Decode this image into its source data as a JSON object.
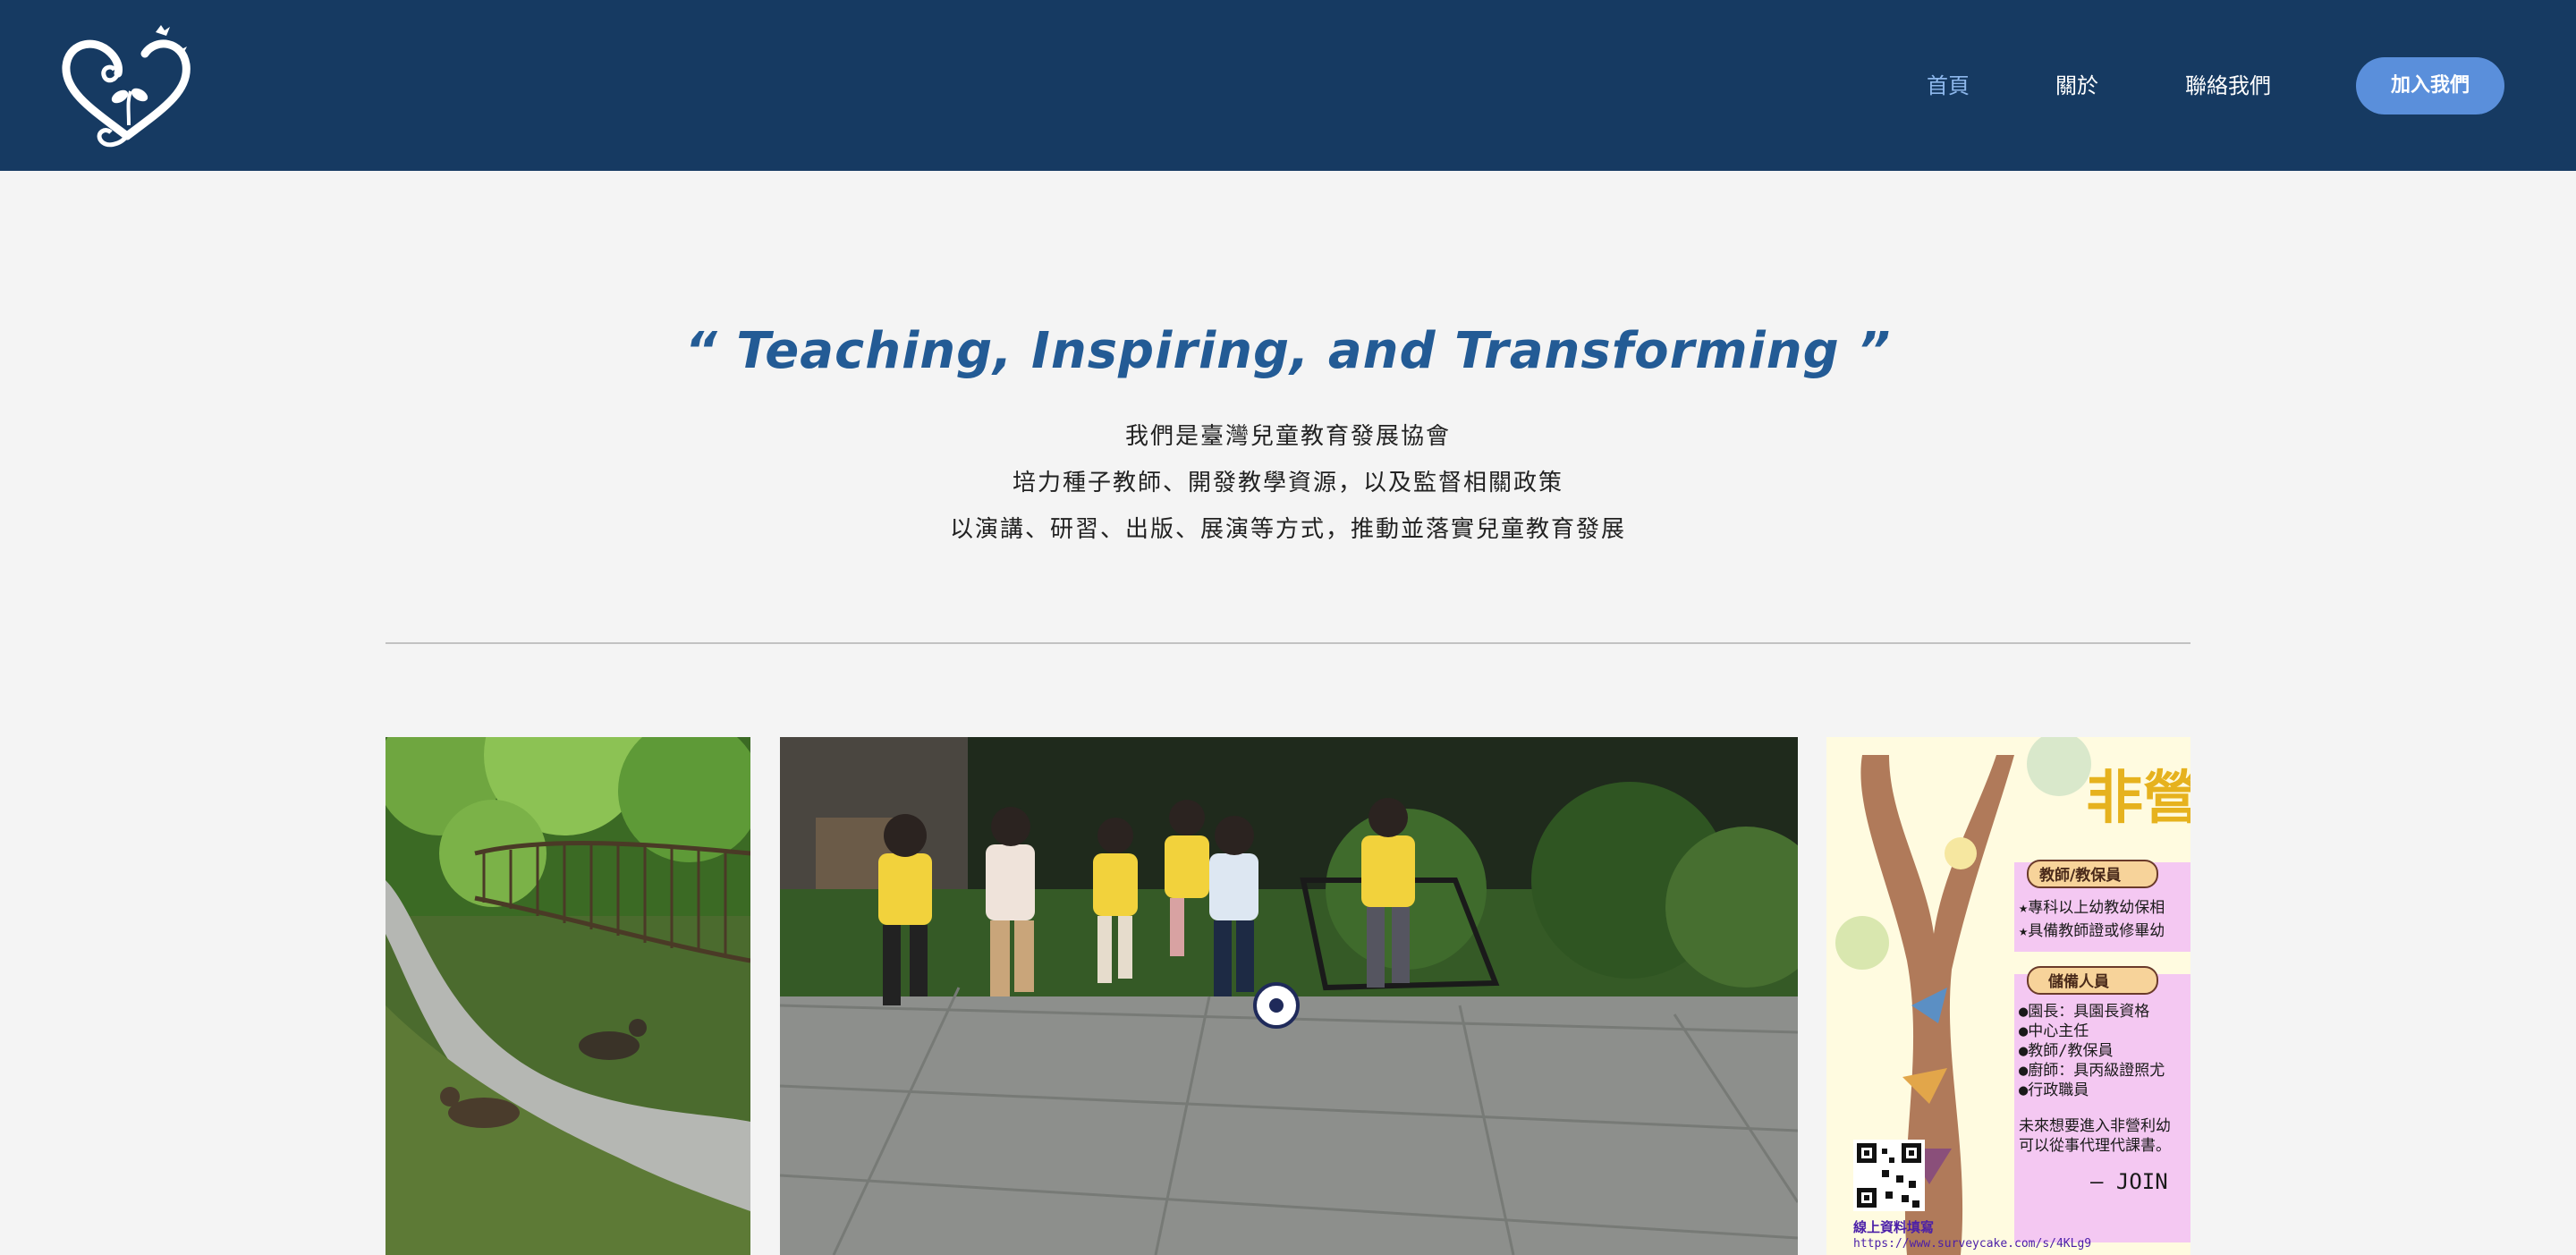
{
  "header": {
    "logo_icon": "heart-bird-logo",
    "nav": [
      {
        "label": "首頁",
        "active": true
      },
      {
        "label": "關於",
        "active": false
      },
      {
        "label": "聯絡我們",
        "active": false
      }
    ],
    "join_button": "加入我們"
  },
  "hero": {
    "tagline": "“ Teaching, Inspiring, and Transforming ”",
    "lines": [
      "我們是臺灣兒童教育發展協會",
      "培力種子教師、開發教學資源，以及監督相關政策",
      "以演講、研習、出版、展演等方式，推動並落實兒童教育發展"
    ]
  },
  "gallery": {
    "poster": {
      "title": "非營",
      "section1_title": "教師/教保員",
      "section1_items": [
        "★專科以上幼教幼保相",
        "★具備教師證或修畢幼"
      ],
      "section2_title": "儲備人員",
      "section2_items": [
        "●園長：具園長資格",
        "●中心主任",
        "●教師/教保員",
        "●廚師：具丙級證照尤",
        "●行政職員"
      ],
      "note_lines": [
        "未來想要進入非營利幼",
        "可以從事代理代課書。"
      ],
      "join_text": "— JOIN",
      "online_label": "線上資料填寫",
      "url": "https://www.surveycake.com/s/4KLg9"
    }
  },
  "colors": {
    "header_bg": "#163a62",
    "nav_active": "#8db7ec",
    "button_bg": "#5a8fdb",
    "tagline": "#235b95",
    "page_bg": "#f4f4f4"
  }
}
